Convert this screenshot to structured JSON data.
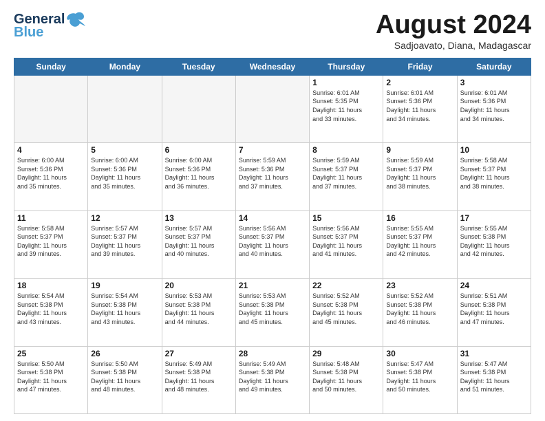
{
  "header": {
    "logo_line1": "General",
    "logo_line2": "Blue",
    "title": "August 2024",
    "subtitle": "Sadjoavato, Diana, Madagascar"
  },
  "weekdays": [
    "Sunday",
    "Monday",
    "Tuesday",
    "Wednesday",
    "Thursday",
    "Friday",
    "Saturday"
  ],
  "weeks": [
    [
      {
        "day": "",
        "info": ""
      },
      {
        "day": "",
        "info": ""
      },
      {
        "day": "",
        "info": ""
      },
      {
        "day": "",
        "info": ""
      },
      {
        "day": "1",
        "info": "Sunrise: 6:01 AM\nSunset: 5:35 PM\nDaylight: 11 hours\nand 33 minutes."
      },
      {
        "day": "2",
        "info": "Sunrise: 6:01 AM\nSunset: 5:36 PM\nDaylight: 11 hours\nand 34 minutes."
      },
      {
        "day": "3",
        "info": "Sunrise: 6:01 AM\nSunset: 5:36 PM\nDaylight: 11 hours\nand 34 minutes."
      }
    ],
    [
      {
        "day": "4",
        "info": "Sunrise: 6:00 AM\nSunset: 5:36 PM\nDaylight: 11 hours\nand 35 minutes."
      },
      {
        "day": "5",
        "info": "Sunrise: 6:00 AM\nSunset: 5:36 PM\nDaylight: 11 hours\nand 35 minutes."
      },
      {
        "day": "6",
        "info": "Sunrise: 6:00 AM\nSunset: 5:36 PM\nDaylight: 11 hours\nand 36 minutes."
      },
      {
        "day": "7",
        "info": "Sunrise: 5:59 AM\nSunset: 5:36 PM\nDaylight: 11 hours\nand 37 minutes."
      },
      {
        "day": "8",
        "info": "Sunrise: 5:59 AM\nSunset: 5:37 PM\nDaylight: 11 hours\nand 37 minutes."
      },
      {
        "day": "9",
        "info": "Sunrise: 5:59 AM\nSunset: 5:37 PM\nDaylight: 11 hours\nand 38 minutes."
      },
      {
        "day": "10",
        "info": "Sunrise: 5:58 AM\nSunset: 5:37 PM\nDaylight: 11 hours\nand 38 minutes."
      }
    ],
    [
      {
        "day": "11",
        "info": "Sunrise: 5:58 AM\nSunset: 5:37 PM\nDaylight: 11 hours\nand 39 minutes."
      },
      {
        "day": "12",
        "info": "Sunrise: 5:57 AM\nSunset: 5:37 PM\nDaylight: 11 hours\nand 39 minutes."
      },
      {
        "day": "13",
        "info": "Sunrise: 5:57 AM\nSunset: 5:37 PM\nDaylight: 11 hours\nand 40 minutes."
      },
      {
        "day": "14",
        "info": "Sunrise: 5:56 AM\nSunset: 5:37 PM\nDaylight: 11 hours\nand 40 minutes."
      },
      {
        "day": "15",
        "info": "Sunrise: 5:56 AM\nSunset: 5:37 PM\nDaylight: 11 hours\nand 41 minutes."
      },
      {
        "day": "16",
        "info": "Sunrise: 5:55 AM\nSunset: 5:37 PM\nDaylight: 11 hours\nand 42 minutes."
      },
      {
        "day": "17",
        "info": "Sunrise: 5:55 AM\nSunset: 5:38 PM\nDaylight: 11 hours\nand 42 minutes."
      }
    ],
    [
      {
        "day": "18",
        "info": "Sunrise: 5:54 AM\nSunset: 5:38 PM\nDaylight: 11 hours\nand 43 minutes."
      },
      {
        "day": "19",
        "info": "Sunrise: 5:54 AM\nSunset: 5:38 PM\nDaylight: 11 hours\nand 43 minutes."
      },
      {
        "day": "20",
        "info": "Sunrise: 5:53 AM\nSunset: 5:38 PM\nDaylight: 11 hours\nand 44 minutes."
      },
      {
        "day": "21",
        "info": "Sunrise: 5:53 AM\nSunset: 5:38 PM\nDaylight: 11 hours\nand 45 minutes."
      },
      {
        "day": "22",
        "info": "Sunrise: 5:52 AM\nSunset: 5:38 PM\nDaylight: 11 hours\nand 45 minutes."
      },
      {
        "day": "23",
        "info": "Sunrise: 5:52 AM\nSunset: 5:38 PM\nDaylight: 11 hours\nand 46 minutes."
      },
      {
        "day": "24",
        "info": "Sunrise: 5:51 AM\nSunset: 5:38 PM\nDaylight: 11 hours\nand 47 minutes."
      }
    ],
    [
      {
        "day": "25",
        "info": "Sunrise: 5:50 AM\nSunset: 5:38 PM\nDaylight: 11 hours\nand 47 minutes."
      },
      {
        "day": "26",
        "info": "Sunrise: 5:50 AM\nSunset: 5:38 PM\nDaylight: 11 hours\nand 48 minutes."
      },
      {
        "day": "27",
        "info": "Sunrise: 5:49 AM\nSunset: 5:38 PM\nDaylight: 11 hours\nand 48 minutes."
      },
      {
        "day": "28",
        "info": "Sunrise: 5:49 AM\nSunset: 5:38 PM\nDaylight: 11 hours\nand 49 minutes."
      },
      {
        "day": "29",
        "info": "Sunrise: 5:48 AM\nSunset: 5:38 PM\nDaylight: 11 hours\nand 50 minutes."
      },
      {
        "day": "30",
        "info": "Sunrise: 5:47 AM\nSunset: 5:38 PM\nDaylight: 11 hours\nand 50 minutes."
      },
      {
        "day": "31",
        "info": "Sunrise: 5:47 AM\nSunset: 5:38 PM\nDaylight: 11 hours\nand 51 minutes."
      }
    ]
  ]
}
